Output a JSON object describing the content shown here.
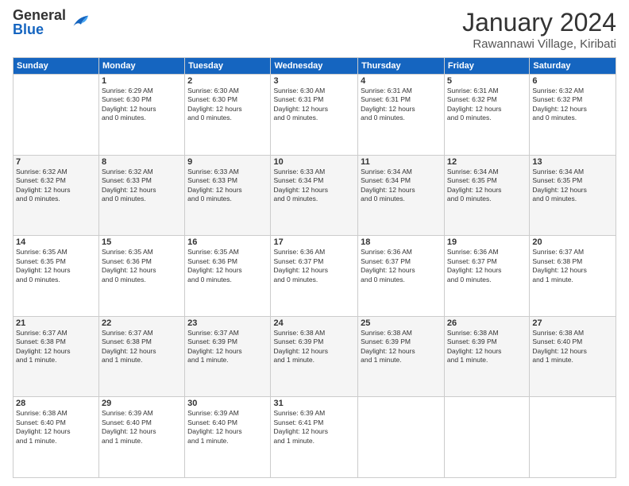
{
  "logo": {
    "general": "General",
    "blue": "Blue"
  },
  "header": {
    "month": "January 2024",
    "location": "Rawannawi Village, Kiribati"
  },
  "weekdays": [
    "Sunday",
    "Monday",
    "Tuesday",
    "Wednesday",
    "Thursday",
    "Friday",
    "Saturday"
  ],
  "weeks": [
    [
      {
        "day": "",
        "info": ""
      },
      {
        "day": "1",
        "info": "Sunrise: 6:29 AM\nSunset: 6:30 PM\nDaylight: 12 hours\nand 0 minutes."
      },
      {
        "day": "2",
        "info": "Sunrise: 6:30 AM\nSunset: 6:30 PM\nDaylight: 12 hours\nand 0 minutes."
      },
      {
        "day": "3",
        "info": "Sunrise: 6:30 AM\nSunset: 6:31 PM\nDaylight: 12 hours\nand 0 minutes."
      },
      {
        "day": "4",
        "info": "Sunrise: 6:31 AM\nSunset: 6:31 PM\nDaylight: 12 hours\nand 0 minutes."
      },
      {
        "day": "5",
        "info": "Sunrise: 6:31 AM\nSunset: 6:32 PM\nDaylight: 12 hours\nand 0 minutes."
      },
      {
        "day": "6",
        "info": "Sunrise: 6:32 AM\nSunset: 6:32 PM\nDaylight: 12 hours\nand 0 minutes."
      }
    ],
    [
      {
        "day": "7",
        "info": "Sunrise: 6:32 AM\nSunset: 6:32 PM\nDaylight: 12 hours\nand 0 minutes."
      },
      {
        "day": "8",
        "info": "Sunrise: 6:32 AM\nSunset: 6:33 PM\nDaylight: 12 hours\nand 0 minutes."
      },
      {
        "day": "9",
        "info": "Sunrise: 6:33 AM\nSunset: 6:33 PM\nDaylight: 12 hours\nand 0 minutes."
      },
      {
        "day": "10",
        "info": "Sunrise: 6:33 AM\nSunset: 6:34 PM\nDaylight: 12 hours\nand 0 minutes."
      },
      {
        "day": "11",
        "info": "Sunrise: 6:34 AM\nSunset: 6:34 PM\nDaylight: 12 hours\nand 0 minutes."
      },
      {
        "day": "12",
        "info": "Sunrise: 6:34 AM\nSunset: 6:35 PM\nDaylight: 12 hours\nand 0 minutes."
      },
      {
        "day": "13",
        "info": "Sunrise: 6:34 AM\nSunset: 6:35 PM\nDaylight: 12 hours\nand 0 minutes."
      }
    ],
    [
      {
        "day": "14",
        "info": "Sunrise: 6:35 AM\nSunset: 6:35 PM\nDaylight: 12 hours\nand 0 minutes."
      },
      {
        "day": "15",
        "info": "Sunrise: 6:35 AM\nSunset: 6:36 PM\nDaylight: 12 hours\nand 0 minutes."
      },
      {
        "day": "16",
        "info": "Sunrise: 6:35 AM\nSunset: 6:36 PM\nDaylight: 12 hours\nand 0 minutes."
      },
      {
        "day": "17",
        "info": "Sunrise: 6:36 AM\nSunset: 6:37 PM\nDaylight: 12 hours\nand 0 minutes."
      },
      {
        "day": "18",
        "info": "Sunrise: 6:36 AM\nSunset: 6:37 PM\nDaylight: 12 hours\nand 0 minutes."
      },
      {
        "day": "19",
        "info": "Sunrise: 6:36 AM\nSunset: 6:37 PM\nDaylight: 12 hours\nand 0 minutes."
      },
      {
        "day": "20",
        "info": "Sunrise: 6:37 AM\nSunset: 6:38 PM\nDaylight: 12 hours\nand 1 minute."
      }
    ],
    [
      {
        "day": "21",
        "info": "Sunrise: 6:37 AM\nSunset: 6:38 PM\nDaylight: 12 hours\nand 1 minute."
      },
      {
        "day": "22",
        "info": "Sunrise: 6:37 AM\nSunset: 6:38 PM\nDaylight: 12 hours\nand 1 minute."
      },
      {
        "day": "23",
        "info": "Sunrise: 6:37 AM\nSunset: 6:39 PM\nDaylight: 12 hours\nand 1 minute."
      },
      {
        "day": "24",
        "info": "Sunrise: 6:38 AM\nSunset: 6:39 PM\nDaylight: 12 hours\nand 1 minute."
      },
      {
        "day": "25",
        "info": "Sunrise: 6:38 AM\nSunset: 6:39 PM\nDaylight: 12 hours\nand 1 minute."
      },
      {
        "day": "26",
        "info": "Sunrise: 6:38 AM\nSunset: 6:39 PM\nDaylight: 12 hours\nand 1 minute."
      },
      {
        "day": "27",
        "info": "Sunrise: 6:38 AM\nSunset: 6:40 PM\nDaylight: 12 hours\nand 1 minute."
      }
    ],
    [
      {
        "day": "28",
        "info": "Sunrise: 6:38 AM\nSunset: 6:40 PM\nDaylight: 12 hours\nand 1 minute."
      },
      {
        "day": "29",
        "info": "Sunrise: 6:39 AM\nSunset: 6:40 PM\nDaylight: 12 hours\nand 1 minute."
      },
      {
        "day": "30",
        "info": "Sunrise: 6:39 AM\nSunset: 6:40 PM\nDaylight: 12 hours\nand 1 minute."
      },
      {
        "day": "31",
        "info": "Sunrise: 6:39 AM\nSunset: 6:41 PM\nDaylight: 12 hours\nand 1 minute."
      },
      {
        "day": "",
        "info": ""
      },
      {
        "day": "",
        "info": ""
      },
      {
        "day": "",
        "info": ""
      }
    ]
  ]
}
